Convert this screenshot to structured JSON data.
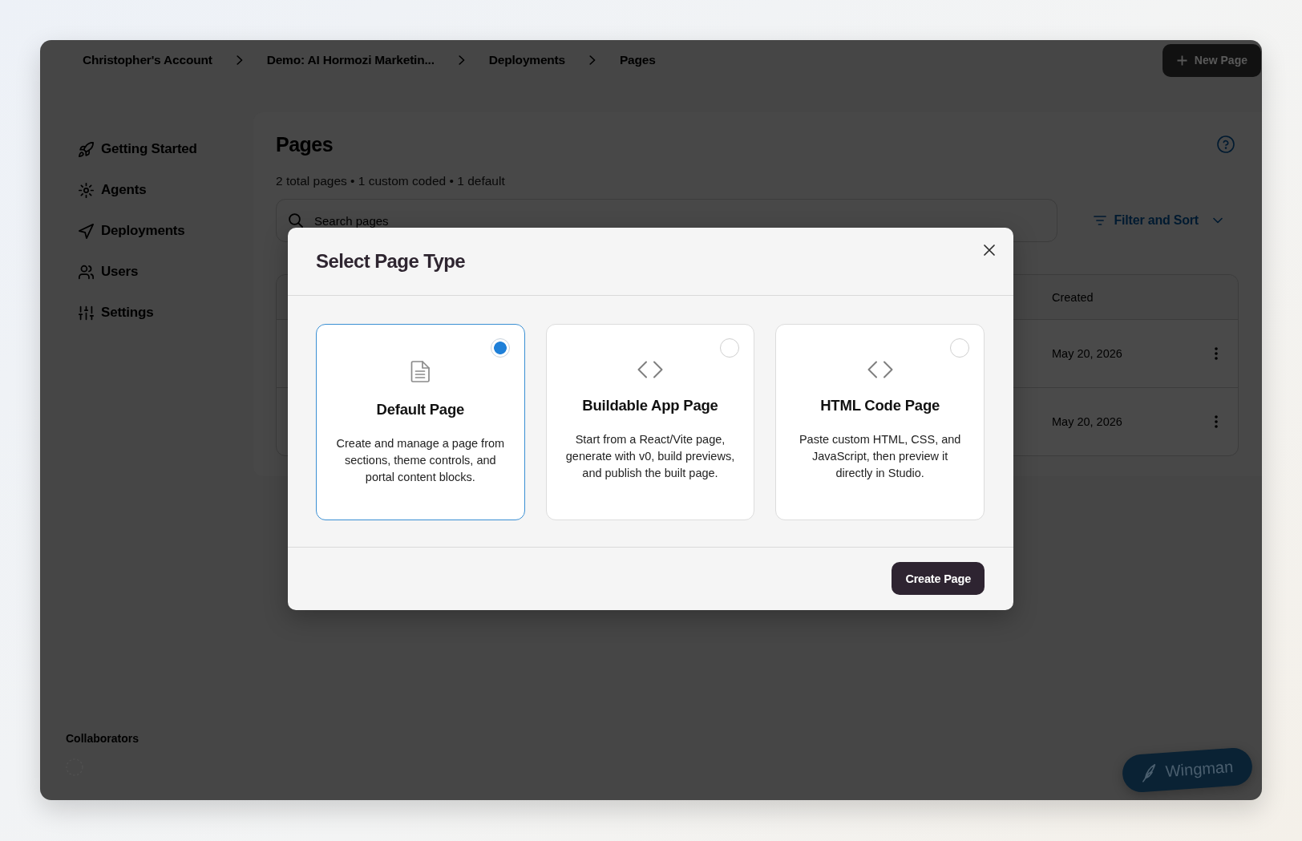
{
  "breadcrumbs": [
    "Christopher's Account",
    "Demo: AI Hormozi Marketin...",
    "Deployments",
    "Pages"
  ],
  "new_page_button": "New Page",
  "sidebar": {
    "items": [
      {
        "label": "Getting Started",
        "selected": false
      },
      {
        "label": "Agents",
        "selected": false
      },
      {
        "label": "Deployments",
        "selected": false
      },
      {
        "label": "Users",
        "selected": false
      },
      {
        "label": "Settings",
        "selected": false
      }
    ],
    "collaborators_label": "Collaborators"
  },
  "page": {
    "title": "Pages",
    "summary": "2 total pages • 1 custom coded • 1 default",
    "search": {
      "placeholder": "Search pages"
    },
    "filter_button": "Filter and Sort",
    "table": {
      "columns": [
        "Created"
      ],
      "rows": [
        {
          "created": "May 20, 2026"
        },
        {
          "created": "May 20, 2026"
        }
      ]
    }
  },
  "modal": {
    "title": "Select Page Type",
    "options": [
      {
        "kind": "default",
        "title": "Default Page",
        "description": "Create and manage a page from sections, theme controls, and portal content blocks.",
        "selected": true
      },
      {
        "kind": "app",
        "title": "Buildable App Page",
        "description": "Start from a React/Vite page, generate with v0, build previews, and publish the built page.",
        "selected": false
      },
      {
        "kind": "html",
        "title": "HTML Code Page",
        "description": "Paste custom HTML, CSS, and JavaScript, then preview it directly in Studio.",
        "selected": false
      }
    ],
    "primary_button": "Create Page"
  },
  "wingman_button": "Wingman"
}
